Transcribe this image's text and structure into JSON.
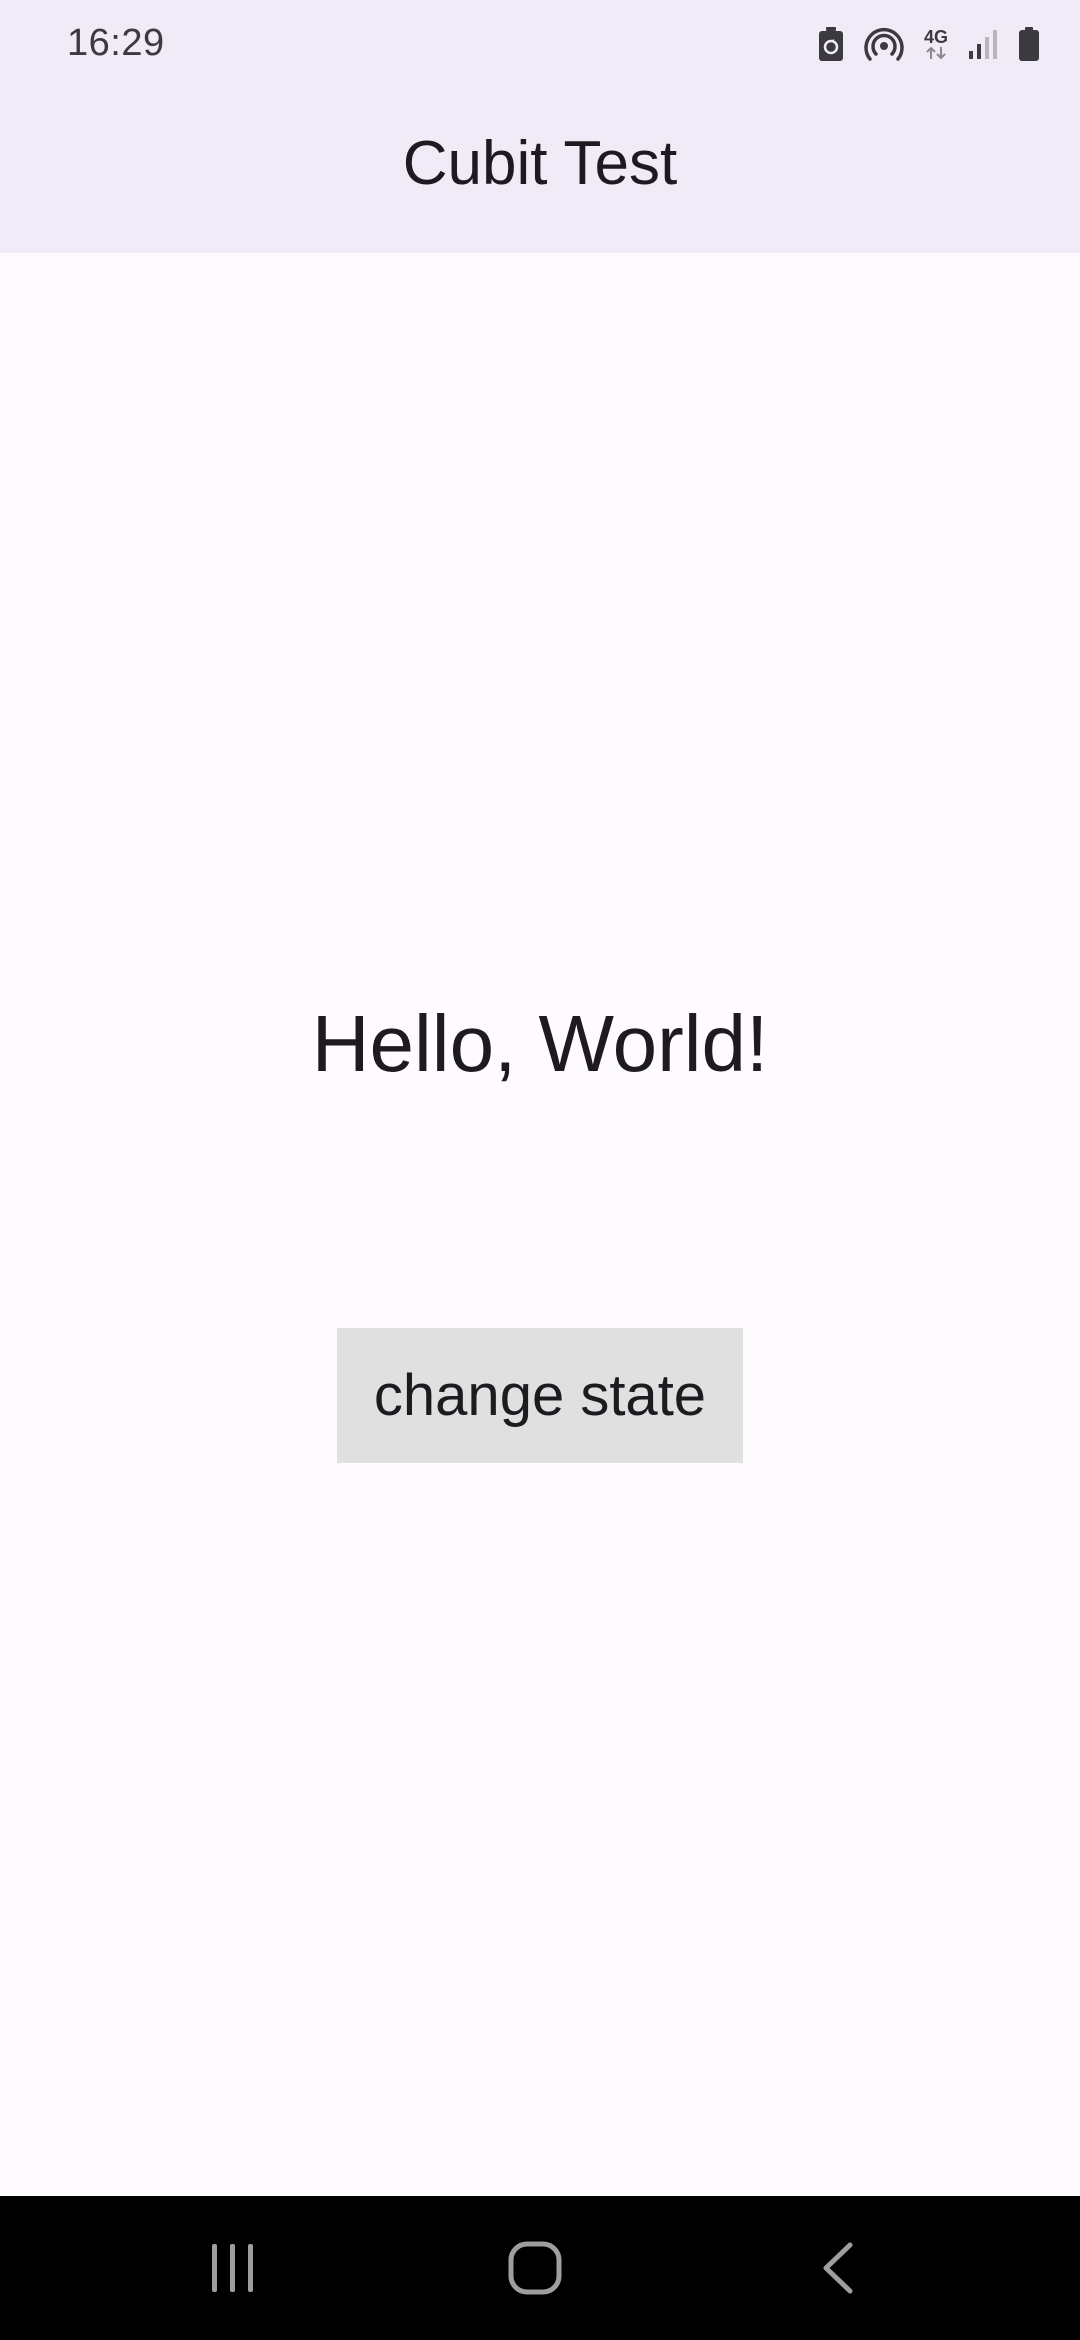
{
  "status_bar": {
    "time": "16:29",
    "icons": [
      "battery-saver-icon",
      "hotspot-icon",
      "network-4g-icon",
      "signal-icon",
      "battery-icon"
    ],
    "network_label": "4G"
  },
  "app_bar": {
    "title": "Cubit Test",
    "background_color": "#f1eaf7"
  },
  "main": {
    "greeting": "Hello, World!",
    "button_label": "change state",
    "button_color": "#e0e0e0",
    "background_color": "#fefbff"
  },
  "navigation_bar": {
    "buttons": [
      "recents-icon",
      "home-icon",
      "back-icon"
    ],
    "background_color": "#000000"
  }
}
